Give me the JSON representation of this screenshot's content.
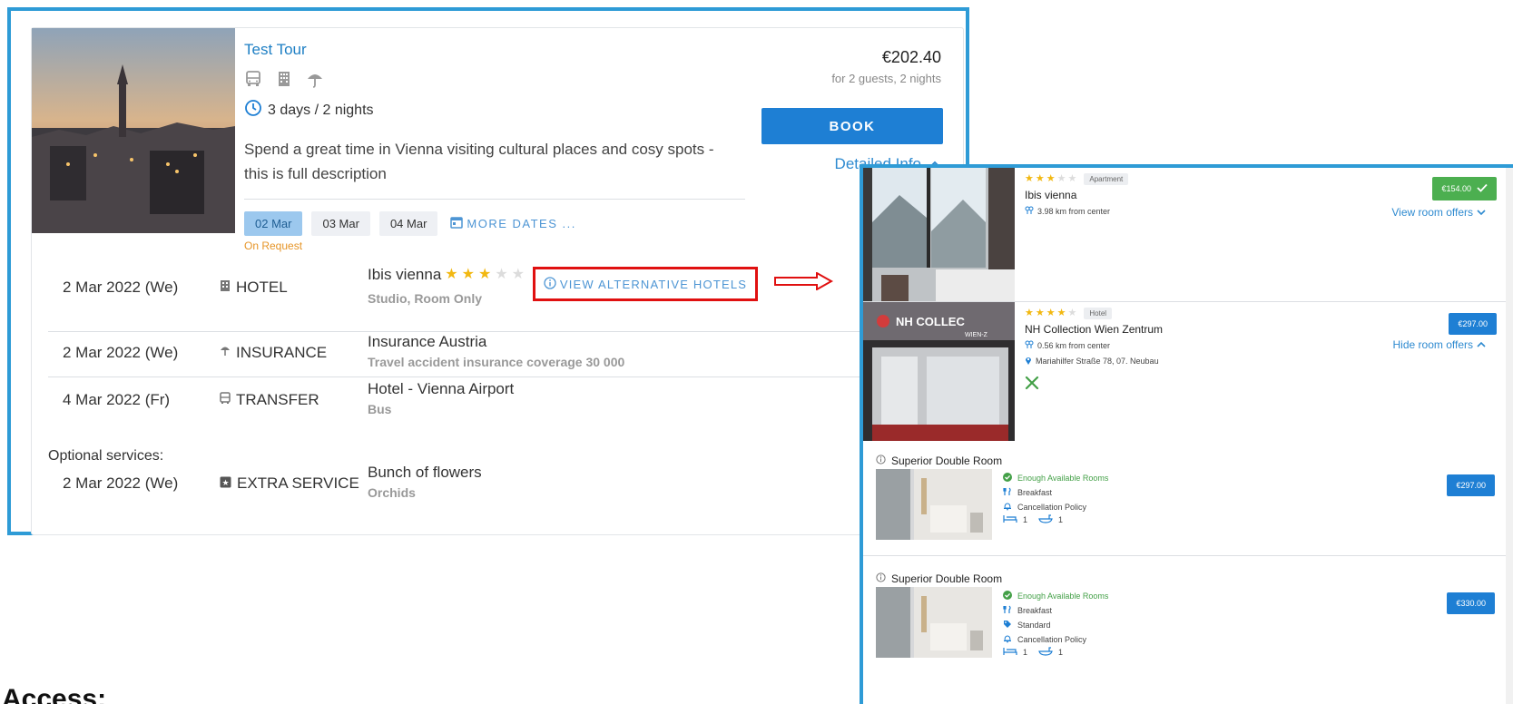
{
  "tour": {
    "title": "Test Tour",
    "duration": "3 days / 2 nights",
    "description": "Spend a great time in Vienna visiting cultural places and cosy spots - this is full description",
    "price": "€202.40",
    "price_note": "for 2 guests, 2 nights",
    "book_label": "BOOK",
    "detailed_info_label": "Detailed Info",
    "dates": [
      "02 Mar",
      "03 Mar",
      "04 Mar"
    ],
    "selected_date": "02 Mar",
    "more_dates_label": "MORE DATES ...",
    "availability": "On Request",
    "icons": [
      "bus-icon",
      "building-icon",
      "umbrella-icon",
      "clock-icon"
    ]
  },
  "services": [
    {
      "date": "2 Mar 2022 (We)",
      "type": "HOTEL",
      "name": "Ibis vienna",
      "stars": 3,
      "max_stars": 5,
      "sub": "Studio, Room Only",
      "icon": "building-icon"
    },
    {
      "date": "2 Mar 2022 (We)",
      "type": "INSURANCE",
      "name": "Insurance Austria",
      "sub": "Travel accident insurance coverage 30 000",
      "icon": "umbrella-icon"
    },
    {
      "date": "4 Mar 2022 (Fr)",
      "type": "TRANSFER",
      "name": "Hotel - Vienna Airport",
      "sub": "Bus",
      "icon": "bus-icon"
    }
  ],
  "view_alternative_label": "VIEW ALTERNATIVE HOTELS",
  "optional_label": "Optional services:",
  "optional_services": [
    {
      "date": "2 Mar 2022 (We)",
      "type": "EXTRA SERVICE",
      "name": "Bunch of flowers",
      "sub": "Orchids",
      "icon": "star-box-icon"
    }
  ],
  "hotels_panel": {
    "hotels": [
      {
        "name": "Ibis vienna",
        "stars": 3,
        "max_stars": 5,
        "badge": "Apartment",
        "distance": "3.98 km from center",
        "price": "€154.00",
        "selected": true,
        "offers_link": "View room offers"
      },
      {
        "name": "NH Collection Wien Zentrum",
        "stars": 4,
        "max_stars": 5,
        "badge": "Hotel",
        "distance": "0.56 km from center",
        "address": "Mariahilfer Straße 78, 07. Neubau",
        "price": "€297.00",
        "selected": false,
        "offers_link": "Hide room offers",
        "photo_sign": "NH COLLEC",
        "photo_sign_sub": "WIEN-Z"
      }
    ],
    "rooms": [
      {
        "title": "Superior Double Room",
        "availability": "Enough Available Rooms",
        "features": [
          "Breakfast",
          "Cancellation Policy"
        ],
        "beds": "1",
        "baths": "1",
        "price": "€297.00"
      },
      {
        "title": "Superior Double Room",
        "availability": "Enough Available Rooms",
        "features": [
          "Breakfast",
          "Standard",
          "Cancellation Policy"
        ],
        "beds": "1",
        "baths": "1",
        "price": "€330.00"
      }
    ]
  },
  "access_heading": "Access:",
  "colors": {
    "accent": "#1e7fd4",
    "link": "#2e8ad0",
    "frame": "#2e9bd6",
    "highlight": "#e01010",
    "star": "#f2b811",
    "success": "#4caf50",
    "warning": "#e69528"
  }
}
